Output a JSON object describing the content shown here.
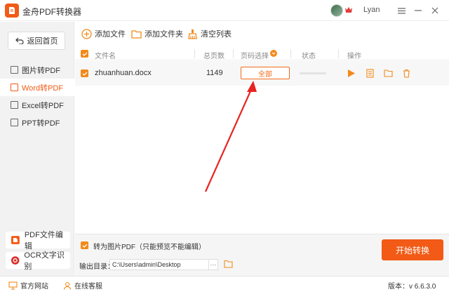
{
  "window": {
    "title": "金舟PDF转换器",
    "user_name": "Lyan",
    "accent_color": "#f25a16"
  },
  "sidebar": {
    "back_label": "返回首页",
    "items": [
      {
        "label": "图片转PDF",
        "icon": "image-icon"
      },
      {
        "label": "Word转PDF",
        "icon": "word-icon",
        "active": true
      },
      {
        "label": "Excel转PDF",
        "icon": "excel-icon"
      },
      {
        "label": "PPT转PDF",
        "icon": "ppt-icon"
      }
    ],
    "tools": [
      {
        "label": "PDF文件编辑",
        "icon": "pdf-edit-icon"
      },
      {
        "label": "OCR文字识别",
        "icon": "ocr-icon"
      }
    ]
  },
  "toolbar": {
    "add_file": "添加文件",
    "add_folder": "添加文件夹",
    "clear_list": "清空列表"
  },
  "table": {
    "headers": {
      "name": "文件名",
      "pages": "总页数",
      "page_select": "页码选择",
      "status": "状态",
      "actions": "操作"
    },
    "rows": [
      {
        "name": "zhuanhuan.docx",
        "pages": "1149",
        "page_select": "全部",
        "progress": 0
      }
    ]
  },
  "bottom": {
    "convert_to_image_pdf": "转为图片PDF（只能预览不能编辑）",
    "output_dir_label": "输出目录：",
    "output_dir_value": "C:\\Users\\admin\\Desktop",
    "more": "···",
    "start_button": "开始转换"
  },
  "statusbar": {
    "website": "官方网站",
    "support": "在线客服",
    "version": "版本：v 6.6.3.0"
  }
}
